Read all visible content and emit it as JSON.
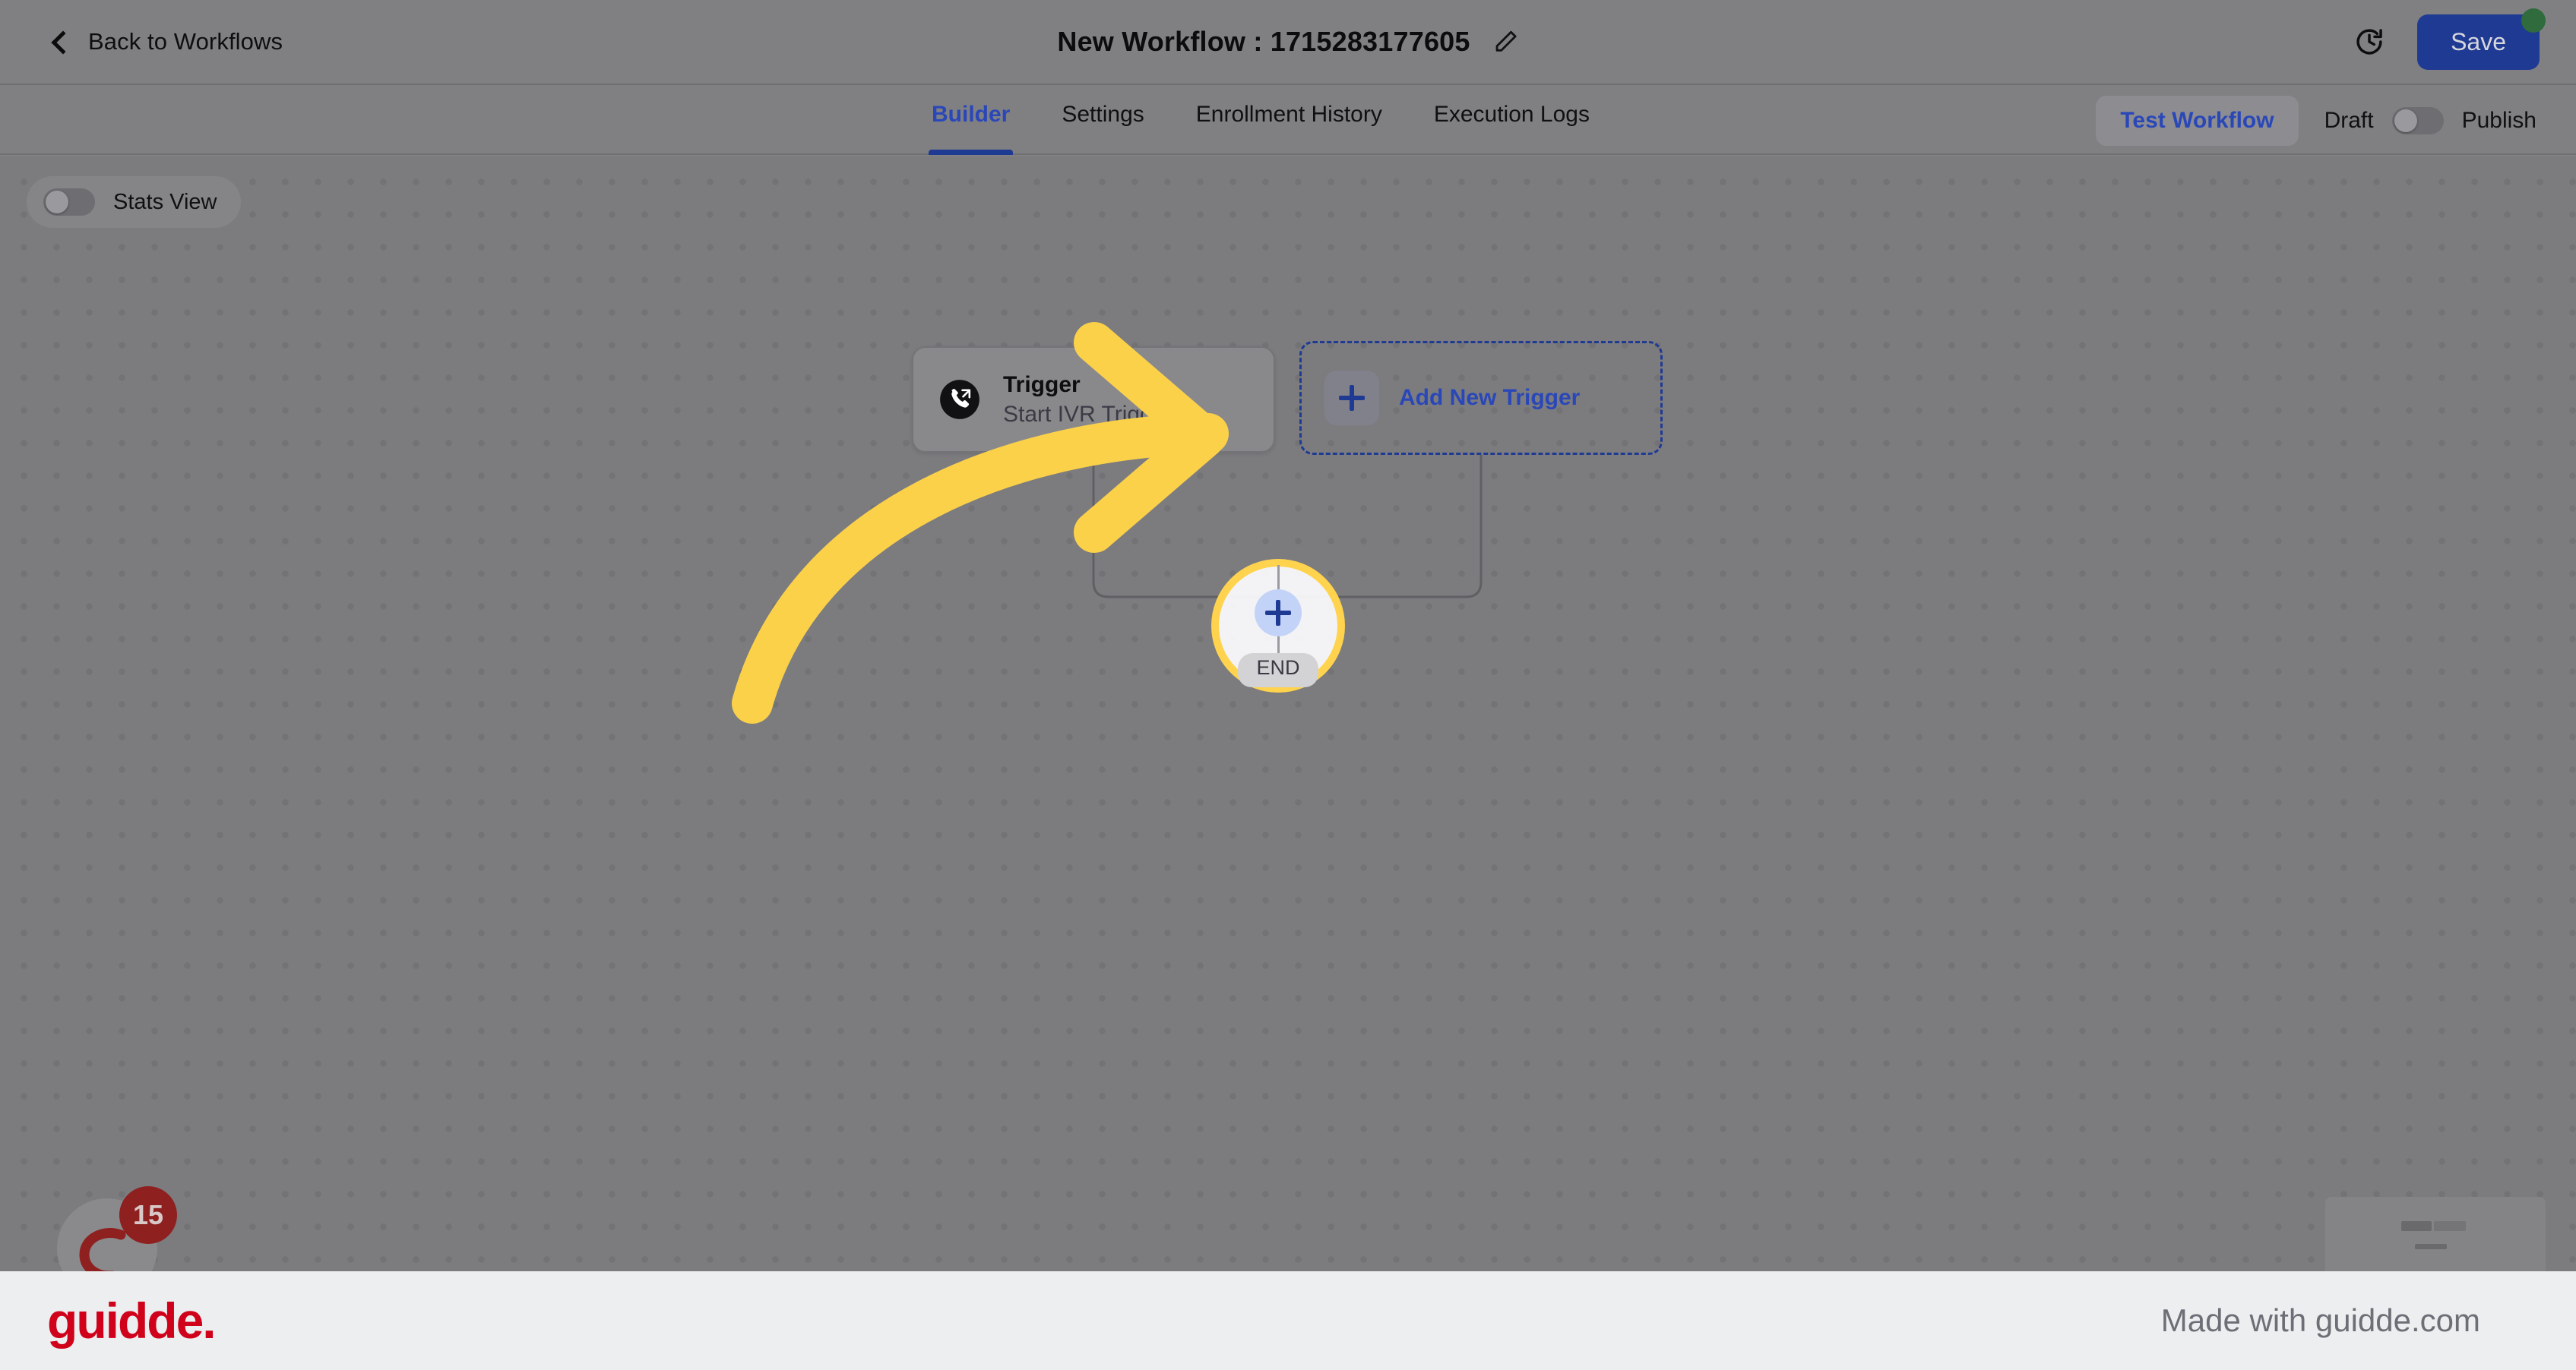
{
  "titlebar": {
    "back_label": "Back to Workflows",
    "back_icon": "chevron-left-icon",
    "workflow_title": "New Workflow : 1715283177605",
    "edit_icon": "pencil-icon",
    "history_icon": "history-clock-icon",
    "save_label": "Save",
    "save_badge_color": "#2f6b3d"
  },
  "tabbar": {
    "tabs": [
      {
        "label": "Builder",
        "active": true
      },
      {
        "label": "Settings",
        "active": false
      },
      {
        "label": "Enrollment History",
        "active": false
      },
      {
        "label": "Execution Logs",
        "active": false
      }
    ],
    "test_workflow_label": "Test Workflow",
    "draft_label": "Draft",
    "publish_label": "Publish",
    "publish_toggle_state": "off"
  },
  "canvas": {
    "stats_view_label": "Stats View",
    "stats_view_toggle_state": "off",
    "trigger_node": {
      "icon": "phone-outgoing-call-icon",
      "title": "Trigger",
      "subtitle": "Start IVR Trigger"
    },
    "add_trigger_node": {
      "icon": "plus-icon",
      "label": "Add New Trigger"
    },
    "end_node": {
      "plus_icon": "plus-icon",
      "label": "END"
    },
    "chat_widget": {
      "badge_count": "15",
      "icon": "chat-bubble-icon"
    },
    "minimap": {
      "name": "canvas-minimap"
    }
  },
  "overlay": {
    "highlight_color": "#ffd34e",
    "arrow_color": "#ffd34e",
    "arrow_icon": "curved-arrow-icon"
  },
  "footer": {
    "logo_text": "guidde.",
    "made_with_text": "Made with guidde.com",
    "logo_color": "#d0021b"
  }
}
